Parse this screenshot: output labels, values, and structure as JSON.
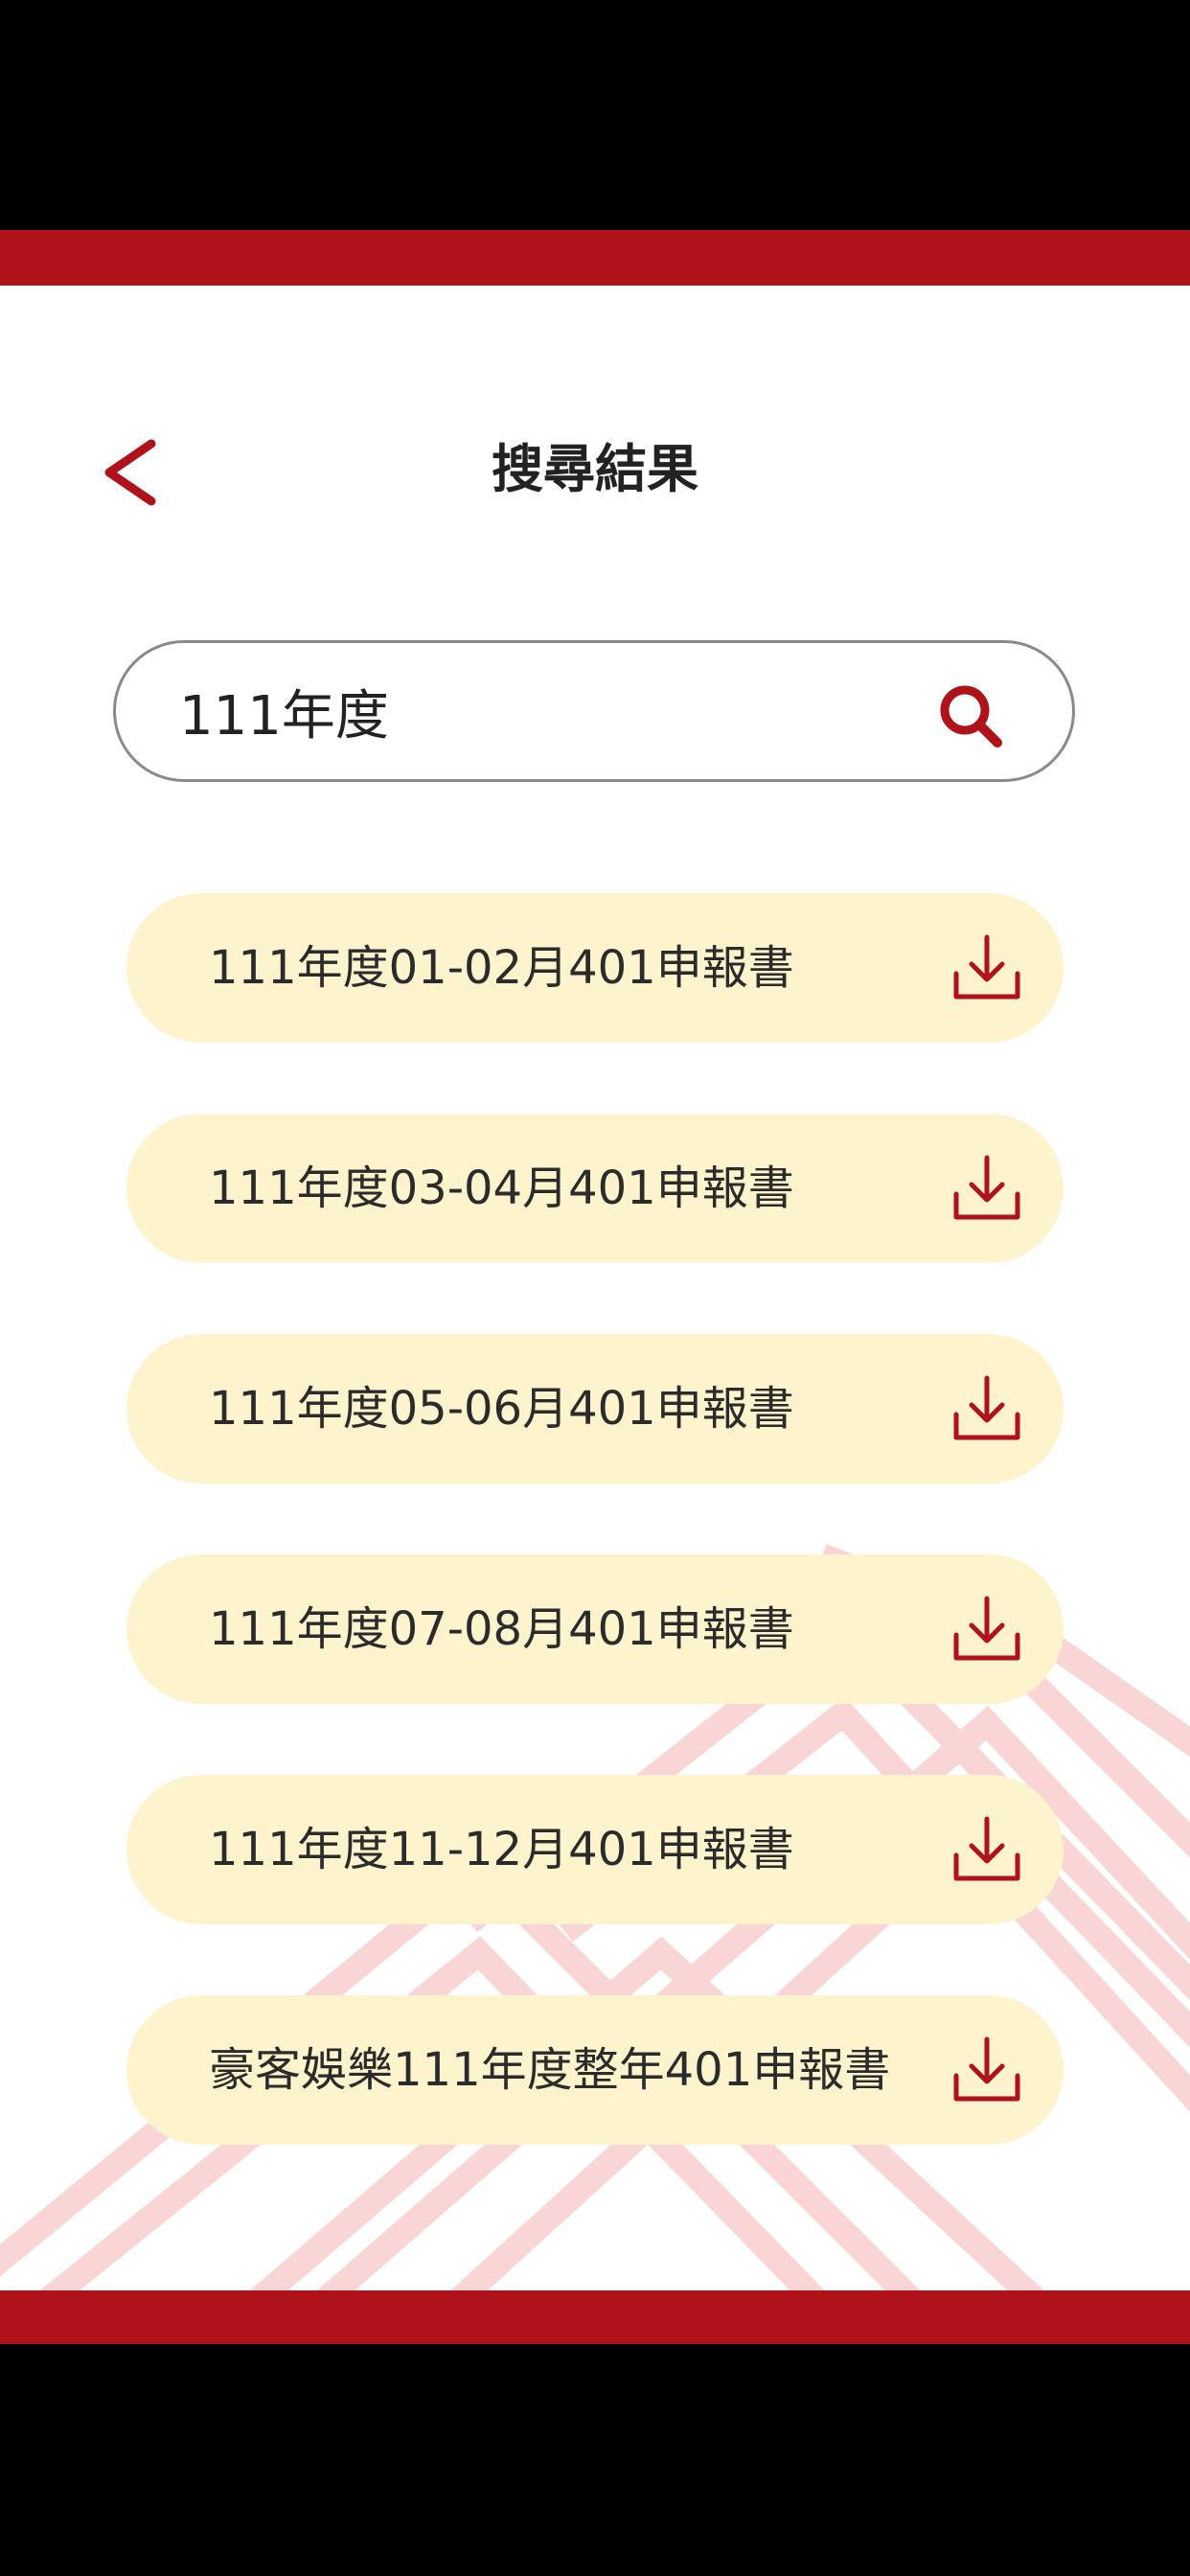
{
  "header": {
    "title": "搜尋結果",
    "back_icon": "chevron-left-icon"
  },
  "search": {
    "value": "111年度",
    "icon": "search-icon"
  },
  "results": [
    {
      "label": "111年度01-02月401申報書",
      "icon": "download-icon"
    },
    {
      "label": "111年度03-04月401申報書",
      "icon": "download-icon"
    },
    {
      "label": "111年度05-06月401申報書",
      "icon": "download-icon"
    },
    {
      "label": "111年度07-08月401申報書",
      "icon": "download-icon"
    },
    {
      "label": "111年度11-12月401申報書",
      "icon": "download-icon"
    },
    {
      "label": "豪客娛樂111年度整年401申報書",
      "icon": "download-icon"
    }
  ],
  "colors": {
    "accent": "#b0121a",
    "item_background": "#fdf3cc",
    "pattern": "#f9d5d6"
  }
}
